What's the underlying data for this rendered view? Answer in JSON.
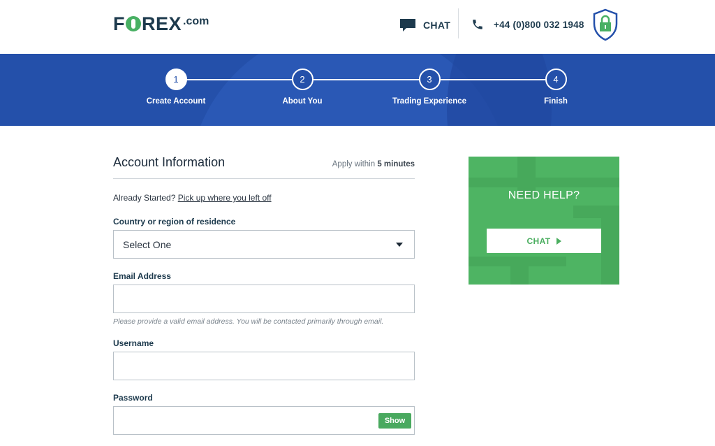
{
  "header": {
    "logo_text": "F REX",
    "logo_domain": ".com",
    "chat_label": "CHAT",
    "phone": "+44 (0)800 032 1948"
  },
  "steps": [
    {
      "number": "1",
      "label": "Create Account",
      "active": true
    },
    {
      "number": "2",
      "label": "About You",
      "active": false
    },
    {
      "number": "3",
      "label": "Trading Experience",
      "active": false
    },
    {
      "number": "4",
      "label": "Finish",
      "active": false
    }
  ],
  "form": {
    "title": "Account Information",
    "apply_prefix": "Apply within ",
    "apply_time": "5 minutes",
    "started_text": "Already Started? ",
    "started_link": "Pick up where you left off",
    "country_label": "Country or region of residence",
    "country_value": "Select One",
    "email_label": "Email Address",
    "email_value": "",
    "email_hint": "Please provide a valid email address. You will be contacted primarily through email.",
    "username_label": "Username",
    "username_value": "",
    "password_label": "Password",
    "password_value": "",
    "show_label": "Show"
  },
  "help": {
    "title": "NEED HELP?",
    "chat_label": "CHAT"
  },
  "colors": {
    "brand_navy": "#1d3a4d",
    "band_blue": "#2450aa",
    "accent_green": "#4eb463"
  },
  "icons": [
    "chat-bubble-icon",
    "phone-icon",
    "shield-lock-icon",
    "dropdown-caret-icon",
    "play-arrow-icon"
  ]
}
